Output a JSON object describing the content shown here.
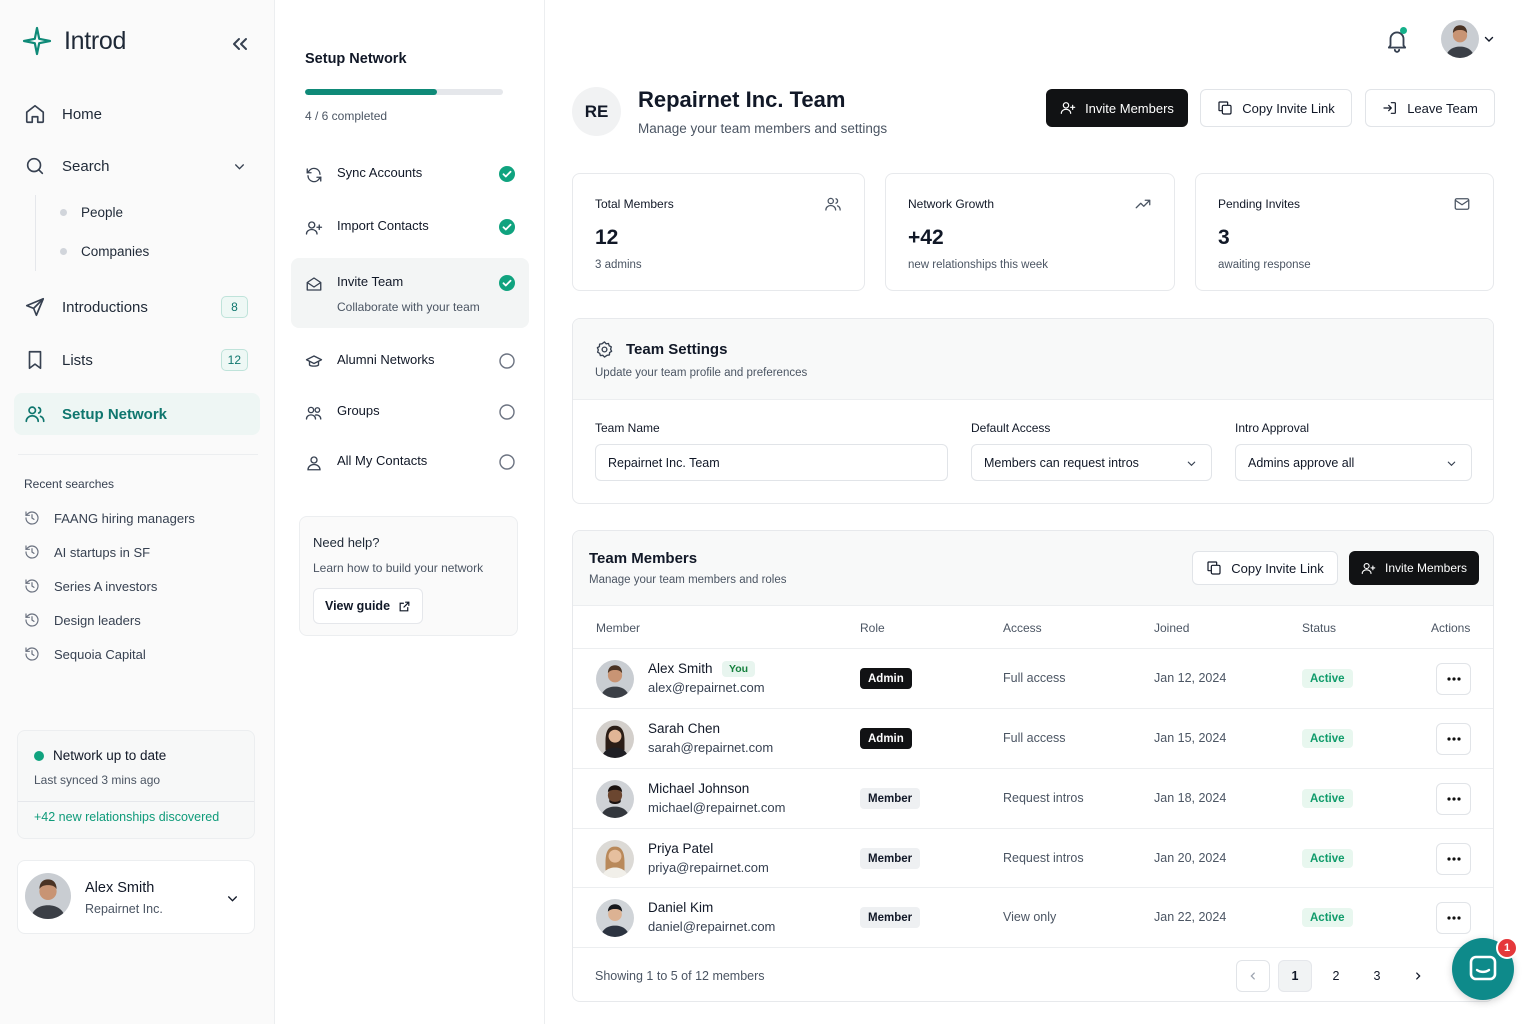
{
  "app": {
    "name": "Introd"
  },
  "sidebar": {
    "nav": [
      {
        "label": "Home",
        "icon": "home-icon"
      },
      {
        "label": "Search",
        "icon": "search-icon"
      },
      {
        "label": "Introductions",
        "icon": "send-icon",
        "badge": "8"
      },
      {
        "label": "Lists",
        "icon": "bookmark-icon",
        "badge": "12"
      },
      {
        "label": "Setup Network",
        "icon": "users-icon",
        "active": true
      }
    ],
    "search_sub": [
      "People",
      "Companies"
    ],
    "recent_title": "Recent searches",
    "recent": [
      "FAANG hiring managers",
      "AI startups in SF",
      "Series A investors",
      "Design leaders",
      "Sequoia Capital"
    ],
    "sync": {
      "title": "Network up to date",
      "sub": "Last synced 3 mins ago",
      "discovered": "+42 new relationships discovered"
    },
    "user": {
      "name": "Alex Smith",
      "company": "Repairnet Inc."
    }
  },
  "setup": {
    "title": "Setup Network",
    "progress": 0.667,
    "progress_text": "4 / 6 completed",
    "steps": [
      {
        "label": "Sync Accounts",
        "done": true
      },
      {
        "label": "Import Contacts",
        "done": true
      },
      {
        "label": "Invite Team",
        "done": true,
        "desc": "Collaborate with your team"
      },
      {
        "label": "Alumni Networks",
        "done": false
      },
      {
        "label": "Groups",
        "done": false
      },
      {
        "label": "All My Contacts",
        "done": false
      }
    ],
    "help": {
      "title": "Need help?",
      "sub": "Learn how to build your network",
      "button": "View guide"
    }
  },
  "header": {
    "initials": "RE",
    "title": "Repairnet Inc. Team",
    "subtitle": "Manage your team members and settings",
    "invite": "Invite Members",
    "copy": "Copy Invite Link",
    "leave": "Leave Team",
    "notifications_dot": true
  },
  "stats": [
    {
      "title": "Total Members",
      "value": "12",
      "sub": "3 admins",
      "icon": "users-icon"
    },
    {
      "title": "Network Growth",
      "value": "+42",
      "sub": "new relationships this week",
      "icon": "trending-up-icon"
    },
    {
      "title": "Pending Invites",
      "value": "3",
      "sub": "awaiting response",
      "icon": "mail-icon"
    }
  ],
  "settings": {
    "title": "Team Settings",
    "sub": "Update your team profile and preferences",
    "team_name_label": "Team Name",
    "team_name_value": "Repairnet Inc. Team",
    "access_label": "Default Access",
    "access_value": "Members can request intros",
    "approval_label": "Intro Approval",
    "approval_value": "Admins approve all"
  },
  "members": {
    "title": "Team Members",
    "sub": "Manage your team members and roles",
    "copy": "Copy Invite Link",
    "invite": "Invite Members",
    "columns": [
      "Member",
      "Role",
      "Access",
      "Joined",
      "Status",
      "Actions"
    ],
    "you_label": "You",
    "rows": [
      {
        "name": "Alex Smith",
        "email": "alex@repairnet.com",
        "role": "Admin",
        "access": "Full access",
        "joined": "Jan 12, 2024",
        "status": "Active",
        "you": true
      },
      {
        "name": "Sarah Chen",
        "email": "sarah@repairnet.com",
        "role": "Admin",
        "access": "Full access",
        "joined": "Jan 15, 2024",
        "status": "Active"
      },
      {
        "name": "Michael Johnson",
        "email": "michael@repairnet.com",
        "role": "Member",
        "access": "Request intros",
        "joined": "Jan 18, 2024",
        "status": "Active"
      },
      {
        "name": "Priya Patel",
        "email": "priya@repairnet.com",
        "role": "Member",
        "access": "Request intros",
        "joined": "Jan 20, 2024",
        "status": "Active"
      },
      {
        "name": "Daniel Kim",
        "email": "daniel@repairnet.com",
        "role": "Member",
        "access": "View only",
        "joined": "Jan 22, 2024",
        "status": "Active"
      }
    ],
    "footer": "Showing 1 to 5 of 12 members",
    "pages": [
      "1",
      "2",
      "3"
    ],
    "current_page": "1"
  },
  "chat": {
    "badge": "1"
  },
  "colors": {
    "accent": "#0f8a78",
    "dark": "#111214",
    "active_bg": "#eef6f4"
  }
}
